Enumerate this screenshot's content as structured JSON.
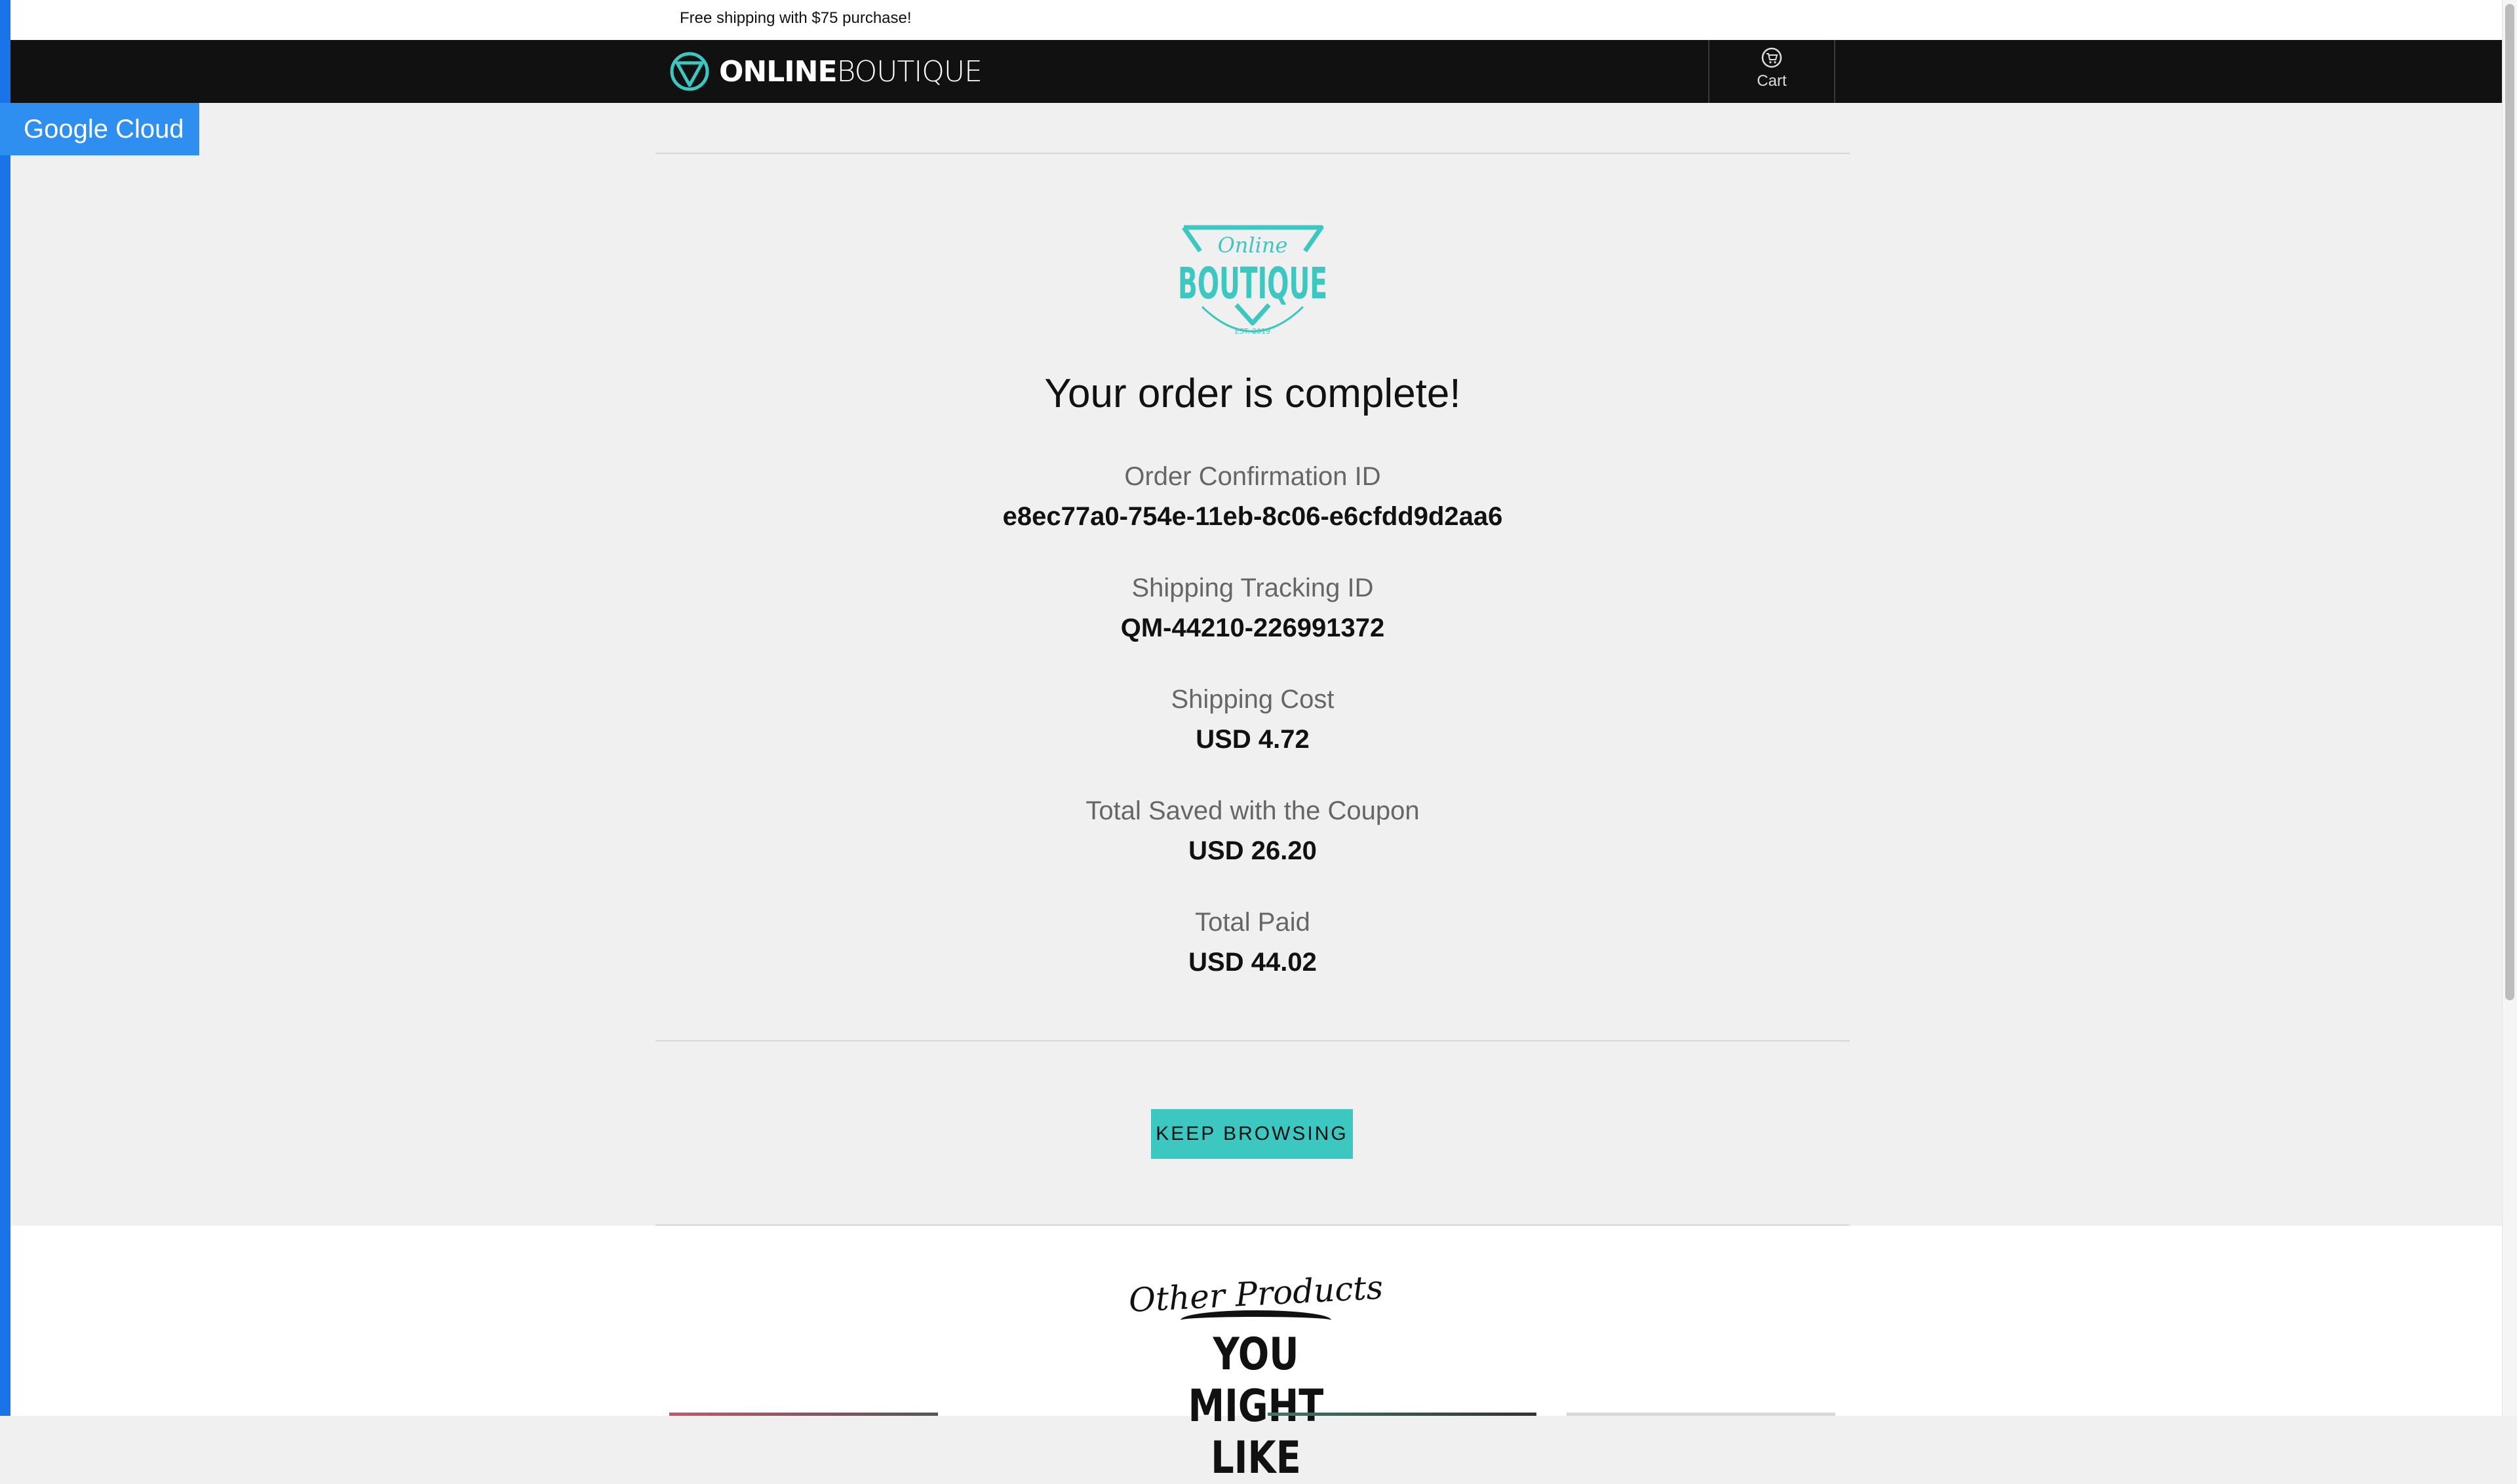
{
  "promo": {
    "text": "Free shipping with $75 purchase!"
  },
  "header": {
    "logo_bold": "ONLINE",
    "logo_light": "BOUTIQUE",
    "cart_label": "Cart",
    "cart_icon": "cart-icon"
  },
  "badge": {
    "label": "Google Cloud"
  },
  "brand_mark": {
    "script": "Online",
    "word": "BOUTIQUE",
    "est": "EST. 2019"
  },
  "order": {
    "title": "Your order is complete!",
    "fields": [
      {
        "label": "Order Confirmation ID",
        "value": "e8ec77a0-754e-11eb-8c06-e6cfdd9d2aa6"
      },
      {
        "label": "Shipping Tracking ID",
        "value": "QM-44210-226991372"
      },
      {
        "label": "Shipping Cost",
        "value": "USD 4.72"
      },
      {
        "label": "Total Saved with the Coupon",
        "value": "USD 26.20"
      },
      {
        "label": "Total Paid",
        "value": "USD 44.02"
      }
    ],
    "button": "KEEP BROWSING"
  },
  "recommendations": {
    "heading_script": "Other Products",
    "heading_main": "YOU MIGHT LIKE"
  },
  "colors": {
    "accent": "#3cc8c1",
    "header_bg": "#111111",
    "badge_bg": "#2f8ff0"
  }
}
